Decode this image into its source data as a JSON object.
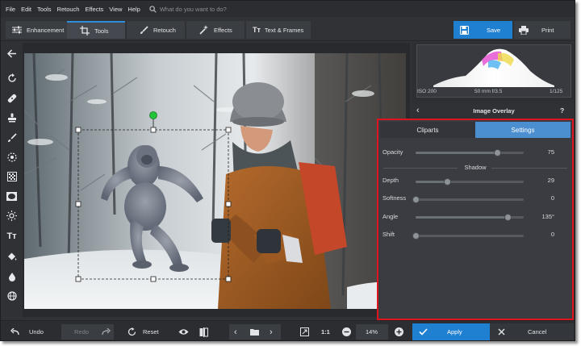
{
  "menu": {
    "items": [
      "File",
      "Edit",
      "Tools",
      "Retouch",
      "Effects",
      "View",
      "Help"
    ],
    "search_placeholder": "What do you want to do?"
  },
  "tabs": [
    {
      "label": "Enhancement",
      "active": false
    },
    {
      "label": "Tools",
      "active": true
    },
    {
      "label": "Retouch",
      "active": false
    },
    {
      "label": "Effects",
      "active": false
    },
    {
      "label": "Text & Frames",
      "active": false
    }
  ],
  "actions": {
    "save_label": "Save",
    "print_label": "Print"
  },
  "camera": {
    "iso": "ISO 200",
    "lens": "50 mm f/3.5",
    "shutter": "1/125"
  },
  "overlay": {
    "title": "Image Overlay",
    "help": "?",
    "tabs": {
      "cliparts": "Cliparts",
      "settings": "Settings"
    },
    "opacity": {
      "label": "Opacity",
      "value": "75",
      "level": 0.75
    },
    "shadow_title": "Shadow",
    "depth": {
      "label": "Depth",
      "value": "29",
      "level": 0.29
    },
    "softness": {
      "label": "Softness",
      "value": "0",
      "level": 0.0
    },
    "angle": {
      "label": "Angle",
      "value": "135°",
      "level": 0.85
    },
    "shift": {
      "label": "Shift",
      "value": "0",
      "level": 0.0
    }
  },
  "bottom": {
    "undo": "Undo",
    "redo": "Redo",
    "reset": "Reset",
    "zoom_fit": "1:1",
    "zoom": "14%",
    "apply": "Apply",
    "cancel": "Cancel"
  },
  "colors": {
    "accent": "#1f7fd1",
    "highlight_border": "#e0141e",
    "handle": "#22c43a"
  }
}
